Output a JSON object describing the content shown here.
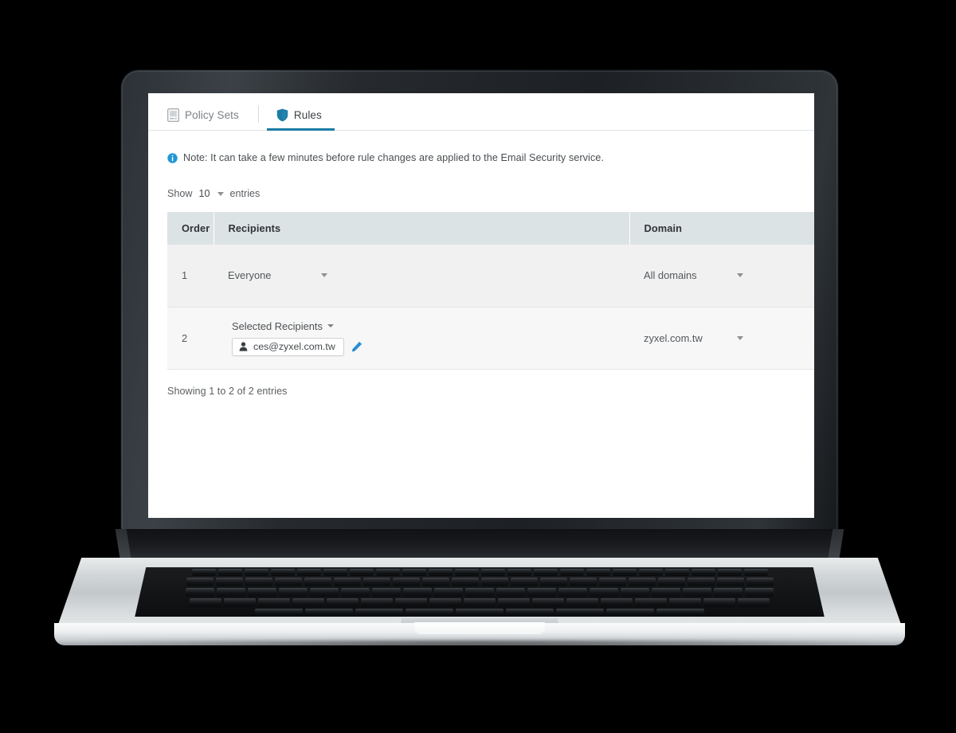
{
  "tabs": [
    {
      "label": "Policy Sets",
      "icon": "document-icon",
      "active": false
    },
    {
      "label": "Rules",
      "icon": "shield-icon",
      "active": true
    }
  ],
  "note": {
    "icon": "info-icon",
    "text": "Note: It can take a few minutes before rule changes are applied to the Email Security service."
  },
  "length_menu": {
    "show_label": "Show",
    "value": "10",
    "entries_label": "entries"
  },
  "table": {
    "columns": [
      "Order",
      "Recipients",
      "Domain"
    ],
    "rows": [
      {
        "order": "1",
        "recipients": {
          "type": "select",
          "value": "Everyone"
        },
        "domain": {
          "type": "select",
          "value": "All domains"
        }
      },
      {
        "order": "2",
        "recipients": {
          "type": "selected",
          "value": "Selected Recipients",
          "chip": {
            "icon": "user-icon",
            "text": "ces@zyxel.com.tw"
          },
          "edit_icon": "pencil-icon"
        },
        "domain": {
          "type": "select",
          "value": "zyxel.com.tw"
        }
      }
    ]
  },
  "footer": {
    "showing_text": "Showing 1 to 2 of 2 entries"
  },
  "colors": {
    "accent": "#1b7ca6",
    "info_icon": "#2196d4",
    "table_header_bg": "#dce3e5",
    "row_odd_bg": "#f1f1f1",
    "row_even_bg": "#f7f7f7",
    "pencil": "#2a8fd4",
    "page_bg": "#000000"
  },
  "device": {
    "type": "laptop",
    "body_color": "#c9cdd0",
    "bezel_color": "#26292d"
  }
}
